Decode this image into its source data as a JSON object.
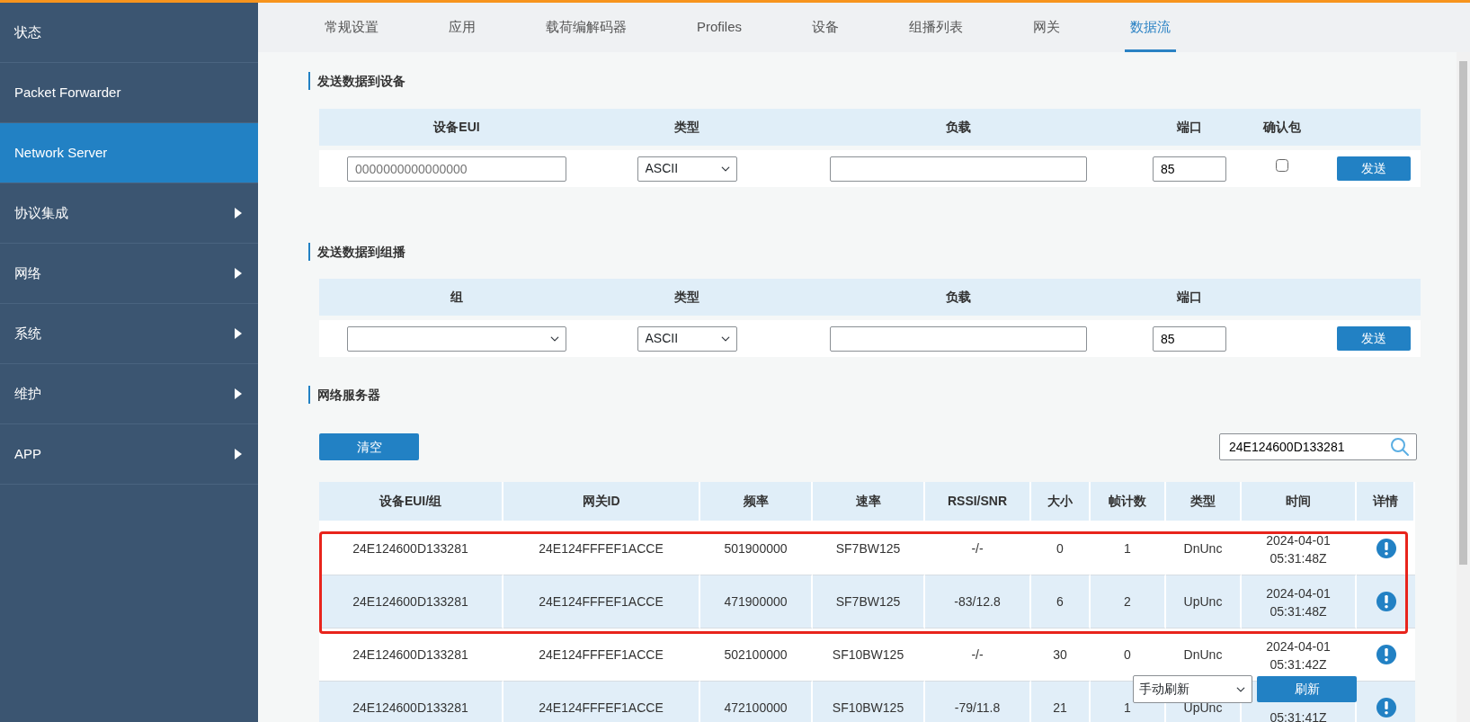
{
  "sidebar": {
    "items": [
      {
        "label": "状态",
        "selected": false,
        "submenu": false
      },
      {
        "label": "Packet Forwarder",
        "selected": false,
        "submenu": false
      },
      {
        "label": "Network Server",
        "selected": true,
        "submenu": false
      },
      {
        "label": "协议集成",
        "selected": false,
        "submenu": true
      },
      {
        "label": "网络",
        "selected": false,
        "submenu": true
      },
      {
        "label": "系统",
        "selected": false,
        "submenu": true
      },
      {
        "label": "维护",
        "selected": false,
        "submenu": true
      },
      {
        "label": "APP",
        "selected": false,
        "submenu": true
      }
    ]
  },
  "tabs": [
    {
      "label": "常规设置",
      "selected": false
    },
    {
      "label": "应用",
      "selected": false
    },
    {
      "label": "载荷编解码器",
      "selected": false
    },
    {
      "label": "Profiles",
      "selected": false
    },
    {
      "label": "设备",
      "selected": false
    },
    {
      "label": "组播列表",
      "selected": false
    },
    {
      "label": "网关",
      "selected": false
    },
    {
      "label": "数据流",
      "selected": true
    }
  ],
  "device_send": {
    "title": "发送数据到设备",
    "columns": [
      "设备EUI",
      "类型",
      "负载",
      "端口",
      "确认包"
    ],
    "eui": {
      "placeholder": "0000000000000000"
    },
    "type": {
      "value": "ASCII"
    },
    "port": {
      "value": "85"
    },
    "confirmed": false,
    "button": "发送"
  },
  "multicast_send": {
    "title": "发送数据到组播",
    "columns": [
      "组",
      "类型",
      "负载",
      "端口"
    ],
    "type": {
      "value": "ASCII"
    },
    "port": {
      "value": "85"
    },
    "button": "发送"
  },
  "network_server": {
    "title": "网络服务器",
    "clear_button": "清空",
    "search": {
      "value": "24E124600D133281"
    },
    "columns": [
      "设备EUI/组",
      "网关ID",
      "频率",
      "速率",
      "RSSI/SNR",
      "大小",
      "帧计数",
      "类型",
      "时间",
      "详情"
    ],
    "rows": [
      {
        "highlighted": true,
        "cells": [
          "24E124600D133281",
          "24E124FFFEF1ACCE",
          "501900000",
          "SF7BW125",
          "-/-",
          "0",
          "1",
          "DnUnc"
        ],
        "time": [
          "2024-04-01",
          "05:31:48Z"
        ]
      },
      {
        "highlighted": true,
        "cells": [
          "24E124600D133281",
          "24E124FFFEF1ACCE",
          "471900000",
          "SF7BW125",
          "-83/12.8",
          "6",
          "2",
          "UpUnc"
        ],
        "time": [
          "2024-04-01",
          "05:31:48Z"
        ]
      },
      {
        "highlighted": false,
        "cells": [
          "24E124600D133281",
          "24E124FFFEF1ACCE",
          "502100000",
          "SF10BW125",
          "-/-",
          "30",
          "0",
          "DnUnc"
        ],
        "time": [
          "2024-04-01",
          "05:31:42Z"
        ]
      },
      {
        "highlighted": false,
        "cells": [
          "24E124600D133281",
          "24E124FFFEF1ACCE",
          "472100000",
          "SF10BW125",
          "-79/11.8",
          "21",
          "1",
          "UpUnc"
        ],
        "time": [
          "05:31:41Z"
        ]
      }
    ],
    "refresh": {
      "mode": "手动刷新",
      "button": "刷新"
    }
  }
}
